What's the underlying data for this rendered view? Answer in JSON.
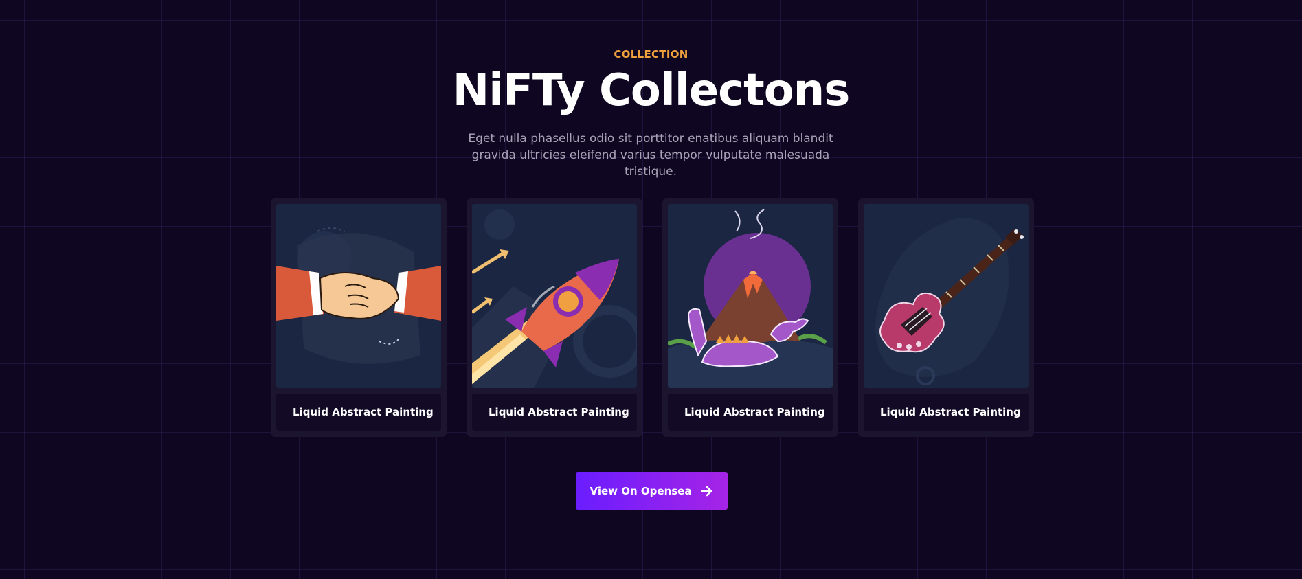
{
  "section": {
    "eyebrow": "COLLECTION",
    "title": "NiFTy Collectons",
    "description": "Eget nulla phasellus odio sit porttitor enatibus aliquam blandit gravida ultricies eleifend varius tempor vulputate malesuada tristique."
  },
  "cards": [
    {
      "label": "Liquid Abstract Painting",
      "icon": "handshake-illustration"
    },
    {
      "label": "Liquid Abstract Painting",
      "icon": "rocket-illustration"
    },
    {
      "label": "Liquid Abstract Painting",
      "icon": "volcano-dinosaur-illustration"
    },
    {
      "label": "Liquid Abstract Painting",
      "icon": "electric-guitar-illustration"
    }
  ],
  "cta": {
    "label": "View On Opensea",
    "icon": "arrow-right-icon"
  },
  "colors": {
    "background": "#0f0622",
    "accent_orange": "#f0a03c",
    "button_start": "#6a1dff",
    "button_end": "#a524e6",
    "card": "#1c1530"
  }
}
